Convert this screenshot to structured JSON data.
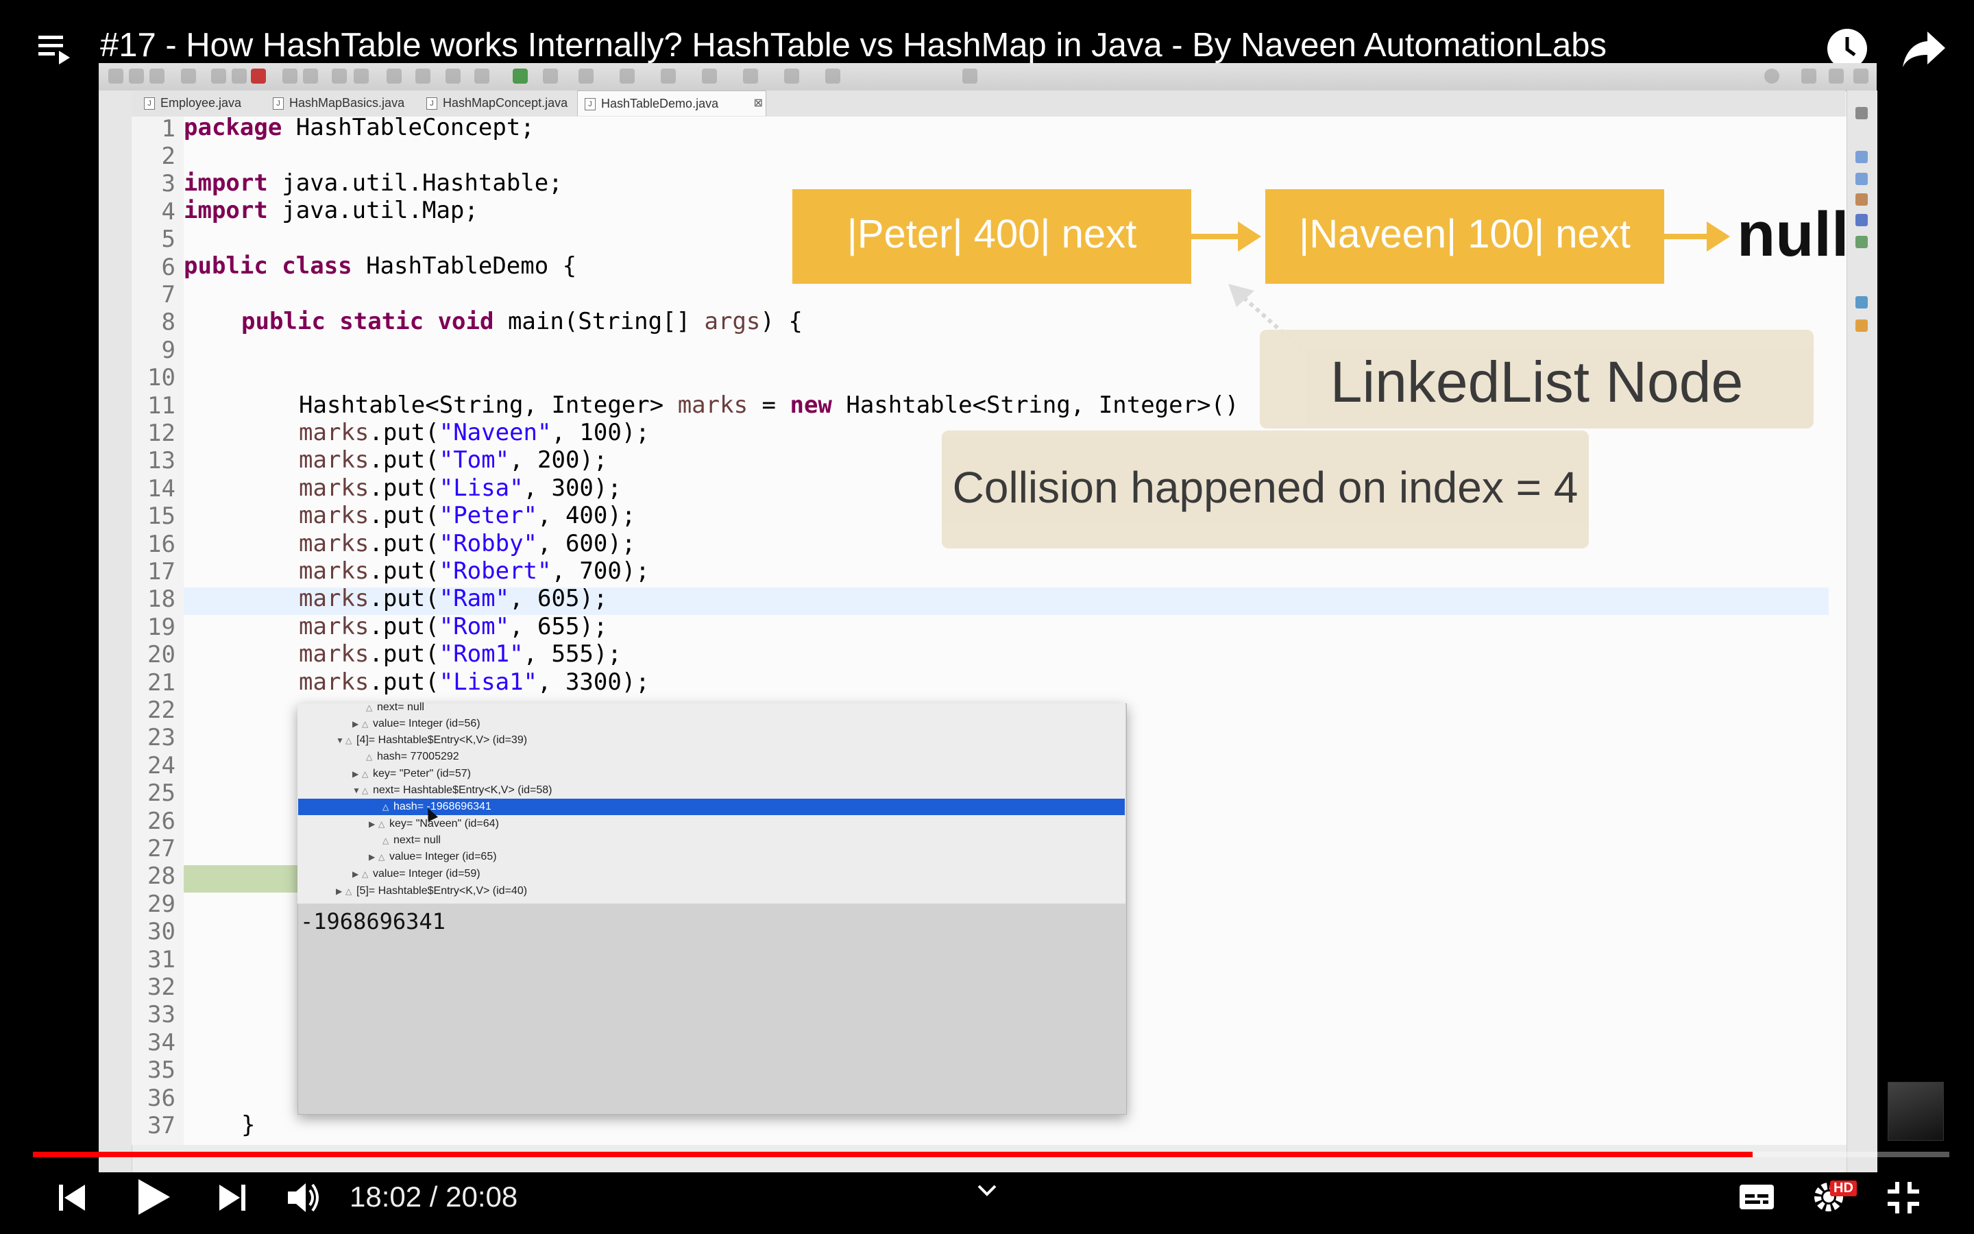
{
  "video": {
    "title": "#17 - How HashTable works Internally? HashTable vs HashMap in Java - By Naveen AutomationLabs",
    "time_display": "18:02 / 20:08",
    "progress_fraction": 0.8975,
    "hd_badge": "HD"
  },
  "ide": {
    "tabs": [
      {
        "label": "Employee.java"
      },
      {
        "label": "HashMapBasics.java"
      },
      {
        "label": "HashMapConcept.java"
      },
      {
        "label": "HashTableDemo.java"
      }
    ],
    "line_numbers": [
      "1",
      "2",
      "3",
      "4",
      "5",
      "6",
      "7",
      "8",
      "9",
      "10",
      "11",
      "12",
      "13",
      "14",
      "15",
      "16",
      "17",
      "18",
      "19",
      "20",
      "21",
      "22",
      "23",
      "24",
      "25",
      "26",
      "27",
      "28",
      "29",
      "30",
      "31",
      "32",
      "33",
      "34",
      "35",
      "36",
      "37"
    ],
    "code": {
      "l1_kw": "package",
      "l1_rest": " HashTableConcept;",
      "l3_kw": "import",
      "l3_rest": " java.util.Hashtable;",
      "l4_kw": "import",
      "l4_rest": " java.util.Map;",
      "l6_kw": "public class",
      "l6_rest": " HashTableDemo {",
      "l8_kw": "public static void",
      "l8_rest": " main(String[] ",
      "l8_var": "args",
      "l8_end": ") {",
      "l11_a": "Hashtable<String, Integer> ",
      "l11_var": "marks",
      "l11_b": " = ",
      "l11_kw": "new",
      "l11_c": " Hashtable<String, Integer>()",
      "puts": [
        {
          "key": "\"Naveen\"",
          "val": ", 100);"
        },
        {
          "key": "\"Tom\"",
          "val": ", 200);"
        },
        {
          "key": "\"Lisa\"",
          "val": ", 300);"
        },
        {
          "key": "\"Peter\"",
          "val": ", 400);"
        },
        {
          "key": "\"Robby\"",
          "val": ", 600);"
        },
        {
          "key": "\"Robert\"",
          "val": ", 700);"
        },
        {
          "key": "\"Ram\"",
          "val": ", 605);"
        },
        {
          "key": "\"Rom\"",
          "val": ", 655);"
        },
        {
          "key": "\"Rom1\"",
          "val": ", 555);"
        },
        {
          "key": "\"Lisa1\"",
          "val": ", 3300);"
        }
      ],
      "put_prefix": "marks",
      "put_call": ".put(",
      "l37": "}"
    },
    "debug_popup": {
      "rows": [
        "next= null",
        "value= Integer  (id=56)",
        "[4]= Hashtable$Entry<K,V>  (id=39)",
        "hash= 77005292",
        "key= \"Peter\" (id=57)",
        "next= Hashtable$Entry<K,V>  (id=58)",
        "hash= -1968696341",
        "key= \"Naveen\" (id=64)",
        "next= null",
        "value= Integer  (id=65)",
        "value= Integer  (id=59)",
        "[5]= Hashtable$Entry<K,V>  (id=40)"
      ],
      "detail_value": "-1968696341"
    }
  },
  "overlay": {
    "node1": "|Peter| 400| next",
    "node2": "|Naveen| 100| next",
    "null_label": "null",
    "linkedlist_label": "LinkedList Node",
    "collision_label": "Collision happened on index = 4",
    "node_color": "#f2bb3f",
    "callout_color": "#ece3d0"
  }
}
